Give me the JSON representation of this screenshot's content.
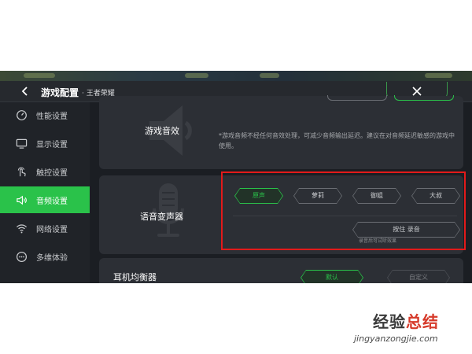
{
  "header": {
    "title": "游戏配置",
    "subtitle": "· 王者荣耀"
  },
  "sidebar": {
    "items": [
      {
        "label": "性能设置",
        "icon": "gauge-icon",
        "active": false
      },
      {
        "label": "显示设置",
        "icon": "monitor-icon",
        "active": false
      },
      {
        "label": "触控设置",
        "icon": "touch-icon",
        "active": false
      },
      {
        "label": "音频设置",
        "icon": "speaker-icon",
        "active": true
      },
      {
        "label": "网络设置",
        "icon": "wifi-icon",
        "active": false
      },
      {
        "label": "多维体验",
        "icon": "more-icon",
        "active": false
      }
    ]
  },
  "game_audio": {
    "title": "游戏音效",
    "note": "*游戏音频不经任何音效处理，可减少音频输出延迟。建议在对音频延迟敏感的游戏中使用。"
  },
  "voice_changer": {
    "title": "语音变声器",
    "options": [
      "原声",
      "萝莉",
      "御姐",
      "大叔"
    ],
    "selected": "原声",
    "record_button": "按住 录音",
    "record_hint": "录音后可试听效果"
  },
  "equalizer": {
    "title": "耳机均衡器",
    "options": [
      "默认",
      "自定义"
    ],
    "selected": "默认"
  },
  "watermark": {
    "text_a": "经验",
    "text_b": "总结",
    "url": "jingyanzongjie.com"
  },
  "colors": {
    "accent": "#2ac24a",
    "highlight_box": "#e21a1a",
    "panel": "#2c2f35",
    "background": "#1b1e23"
  }
}
